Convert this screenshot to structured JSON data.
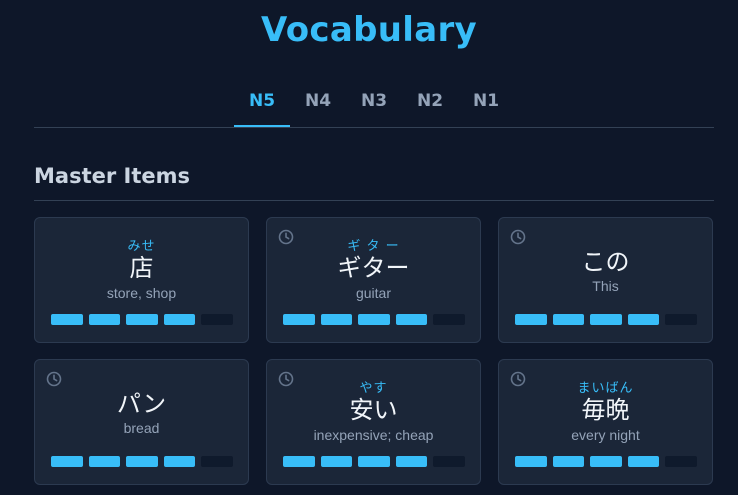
{
  "page": {
    "title": "Vocabulary"
  },
  "tabs": [
    {
      "label": "N5",
      "active": true
    },
    {
      "label": "N4",
      "active": false
    },
    {
      "label": "N3",
      "active": false
    },
    {
      "label": "N2",
      "active": false
    },
    {
      "label": "N1",
      "active": false
    }
  ],
  "section": {
    "title": "Master Items"
  },
  "colors": {
    "accent": "#38bdf8",
    "background": "#0e1729",
    "card": "#1b2638"
  },
  "cards": [
    {
      "furigana": "みせ",
      "word": "店",
      "meaning": "store, shop",
      "review_icon": false,
      "level": 4,
      "max_level": 5
    },
    {
      "furigana": "ギ タ ー",
      "word": "ギター",
      "meaning": "guitar",
      "review_icon": true,
      "level": 4,
      "max_level": 5
    },
    {
      "furigana": "",
      "word": "この",
      "meaning": "This",
      "review_icon": true,
      "level": 4,
      "max_level": 5
    },
    {
      "furigana": "",
      "word": "パン",
      "meaning": "bread",
      "review_icon": true,
      "level": 4,
      "max_level": 5
    },
    {
      "furigana": "やす",
      "word": "安い",
      "meaning": "inexpensive; cheap",
      "review_icon": true,
      "level": 4,
      "max_level": 5
    },
    {
      "furigana": "まいばん",
      "word": "毎晩",
      "meaning": "every night",
      "review_icon": true,
      "level": 4,
      "max_level": 5
    }
  ]
}
